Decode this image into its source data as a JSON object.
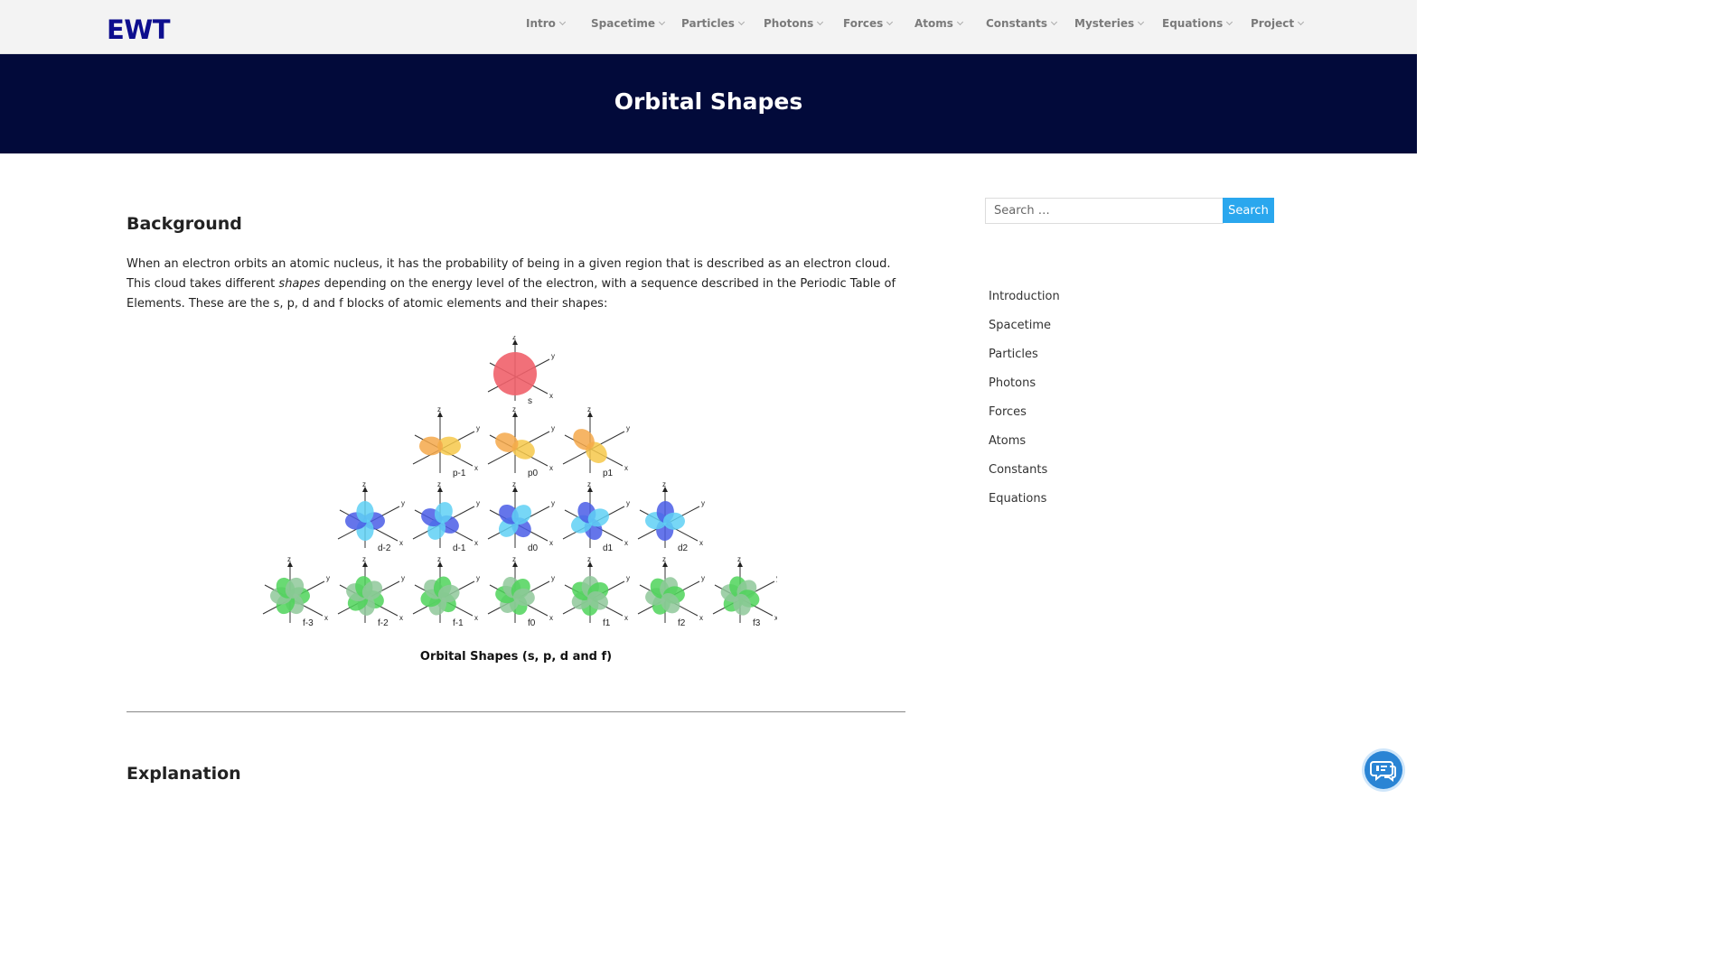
{
  "header": {
    "logo": "EWT",
    "nav": [
      {
        "label": "Intro"
      },
      {
        "label": "Spacetime"
      },
      {
        "label": "Particles"
      },
      {
        "label": "Photons"
      },
      {
        "label": "Forces"
      },
      {
        "label": "Atoms"
      },
      {
        "label": "Constants"
      },
      {
        "label": "Mysteries"
      },
      {
        "label": "Equations"
      },
      {
        "label": "Project"
      }
    ]
  },
  "banner": {
    "title": "Orbital Shapes"
  },
  "content": {
    "background_heading": "Background",
    "paragraph_part1": "When an electron orbits an atomic nucleus, it has the probability of being in a given region that is described as an electron cloud. This cloud takes different ",
    "paragraph_emph": "shapes",
    "paragraph_part2": " depending on the energy level of the electron, with a sequence described in the Periodic Table of Elements. These are the s, p, d and f blocks of atomic elements and their shapes:",
    "figure": {
      "caption": "Orbital Shapes (s, p, d and f)",
      "axis_labels": {
        "z": "z",
        "y": "y",
        "x": "x"
      },
      "rows": [
        {
          "color": "#f0606a",
          "labels": [
            "s"
          ]
        },
        {
          "color": "#f6c84a",
          "labels": [
            "p-1",
            "p0",
            "p1"
          ]
        },
        {
          "color": "#4a5de6",
          "labels": [
            "d-2",
            "d-1",
            "d0",
            "d1",
            "d2"
          ]
        },
        {
          "color": "#4fd45a",
          "labels": [
            "f-3",
            "f-2",
            "f-1",
            "f0",
            "f1",
            "f2",
            "f3"
          ]
        }
      ]
    },
    "explanation_heading": "Explanation"
  },
  "sidebar": {
    "search_placeholder": "Search …",
    "search_button": "Search",
    "links": [
      {
        "label": "Introduction"
      },
      {
        "label": "Spacetime"
      },
      {
        "label": "Particles"
      },
      {
        "label": "Photons"
      },
      {
        "label": "Forces"
      },
      {
        "label": "Atoms"
      },
      {
        "label": "Constants"
      },
      {
        "label": "Equations"
      }
    ]
  },
  "chat": {
    "icon": "chat-ai-icon"
  }
}
